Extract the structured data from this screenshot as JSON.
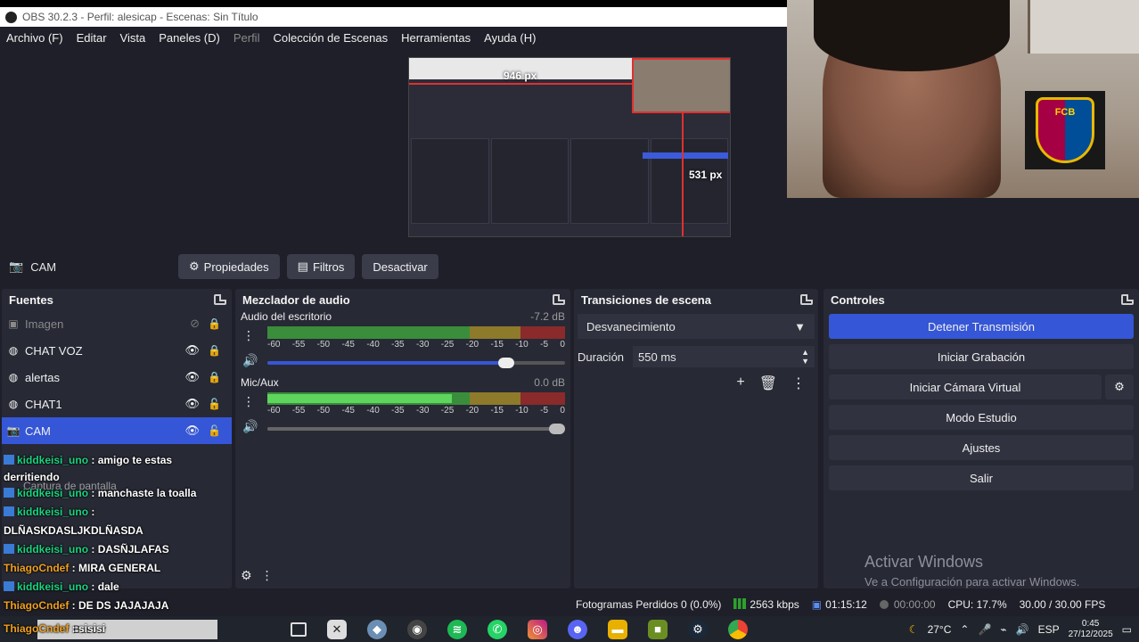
{
  "window": {
    "title": "OBS 30.2.3 - Perfil: alesicap - Escenas: Sin Título"
  },
  "menu": [
    "Archivo (F)",
    "Editar",
    "Vista",
    "Paneles (D)",
    "Perfil",
    "Colección de Escenas",
    "Herramientas",
    "Ayuda (H)"
  ],
  "preview": {
    "width_label": "946 px",
    "height_label": "531 px"
  },
  "source_toolbar": {
    "selected_source": "CAM",
    "properties": "Propiedades",
    "filters": "Filtros",
    "deactivate": "Desactivar"
  },
  "fuentes": {
    "title": "Fuentes",
    "items": [
      {
        "name": "Imagen",
        "visible": false,
        "locked": true
      },
      {
        "name": "CHAT VOZ",
        "visible": true,
        "locked": true
      },
      {
        "name": "alertas",
        "visible": true,
        "locked": true
      },
      {
        "name": "CHAT1",
        "visible": true,
        "locked": false
      },
      {
        "name": "CAM",
        "visible": true,
        "locked": false,
        "selected": true
      }
    ],
    "ghost_item": "Captura de pantalla"
  },
  "chat": [
    {
      "user": "kiddkeisi_uno",
      "text": ": amigo te estas",
      "cont": "derritiendo",
      "color": "green"
    },
    {
      "user": "kiddkeisi_uno",
      "text": ": manchaste la toalla",
      "color": "green"
    },
    {
      "user": "kiddkeisi_uno",
      "text": ":",
      "cont": "DLÑASKDASLJKDLÑASDA",
      "color": "green"
    },
    {
      "user": "kiddkeisi_uno",
      "text": ": DASÑJLAFAS",
      "color": "green"
    },
    {
      "user": "ThiagoCndef",
      "text": ": MIRA GENERAL",
      "color": "orange"
    },
    {
      "user": "kiddkeisi_uno",
      "text": ": dale",
      "color": "green"
    },
    {
      "user": "ThiagoCndef",
      "text": ": DE DS JAJAJAJA",
      "color": "orange"
    },
    {
      "user": "ThiagoCndef",
      "text": ": sisisi",
      "color": "orange"
    }
  ],
  "mixer": {
    "title": "Mezclador de audio",
    "ticks": [
      "-60",
      "-55",
      "-50",
      "-45",
      "-40",
      "-35",
      "-30",
      "-25",
      "-20",
      "-15",
      "-10",
      "-5",
      "0"
    ],
    "channels": [
      {
        "name": "Audio del escritorio",
        "db": "-7.2 dB",
        "level": 0,
        "volume": 0.82
      },
      {
        "name": "Mic/Aux",
        "db": "0.0 dB",
        "level": 0.62,
        "volume": 1.0
      }
    ]
  },
  "transitions": {
    "title": "Transiciones de escena",
    "selected": "Desvanecimiento",
    "duration_label": "Duración",
    "duration_value": "550 ms"
  },
  "controls": {
    "title": "Controles",
    "stop_stream": "Detener Transmisión",
    "start_recording": "Iniciar Grabación",
    "virtual_cam": "Iniciar Cámara Virtual",
    "studio_mode": "Modo Estudio",
    "settings": "Ajustes",
    "exit": "Salir"
  },
  "activation": {
    "line1": "Activar Windows",
    "line2": "Ve a Configuración para activar Windows."
  },
  "status": {
    "dropped": "Fotogramas Perdidos 0 (0.0%)",
    "bitrate": "2563 kbps",
    "stream_time": "01:15:12",
    "rec_time": "00:00:00",
    "cpu": "CPU: 17.7%",
    "fps": "30.00 / 30.00 FPS"
  },
  "taskbar": {
    "search": "Buscar",
    "weather": "27°C",
    "lang": "ESP",
    "time": "0:45",
    "date": "27/12/2025"
  },
  "colors": {
    "accent": "#3556d6",
    "background": "#1e1f29",
    "dock": "#272935"
  }
}
